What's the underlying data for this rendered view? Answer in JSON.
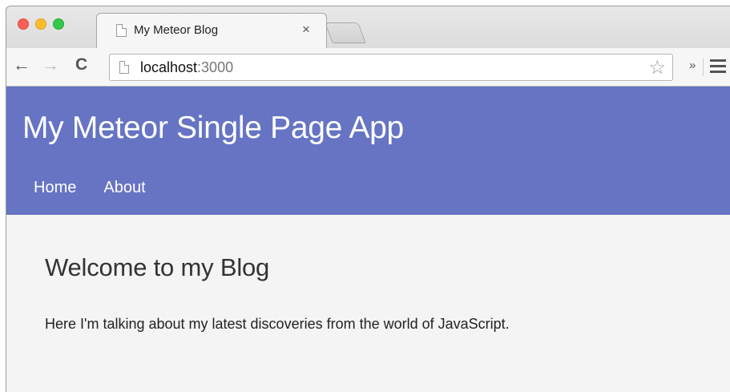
{
  "browser": {
    "tab_title": "My Meteor Blog",
    "tab_close": "×",
    "url_host": "localhost",
    "url_port": ":3000",
    "back_icon": "←",
    "forward_icon": "→",
    "reload_icon": "C",
    "star_icon": "☆",
    "extensions_icon": "»"
  },
  "site": {
    "title": "My Meteor Single Page App",
    "nav": [
      "Home",
      "About"
    ],
    "header_color": "#6674c3"
  },
  "content": {
    "heading": "Welcome to my Blog",
    "body": "Here I'm talking about my latest discoveries from the world of JavaScript."
  }
}
